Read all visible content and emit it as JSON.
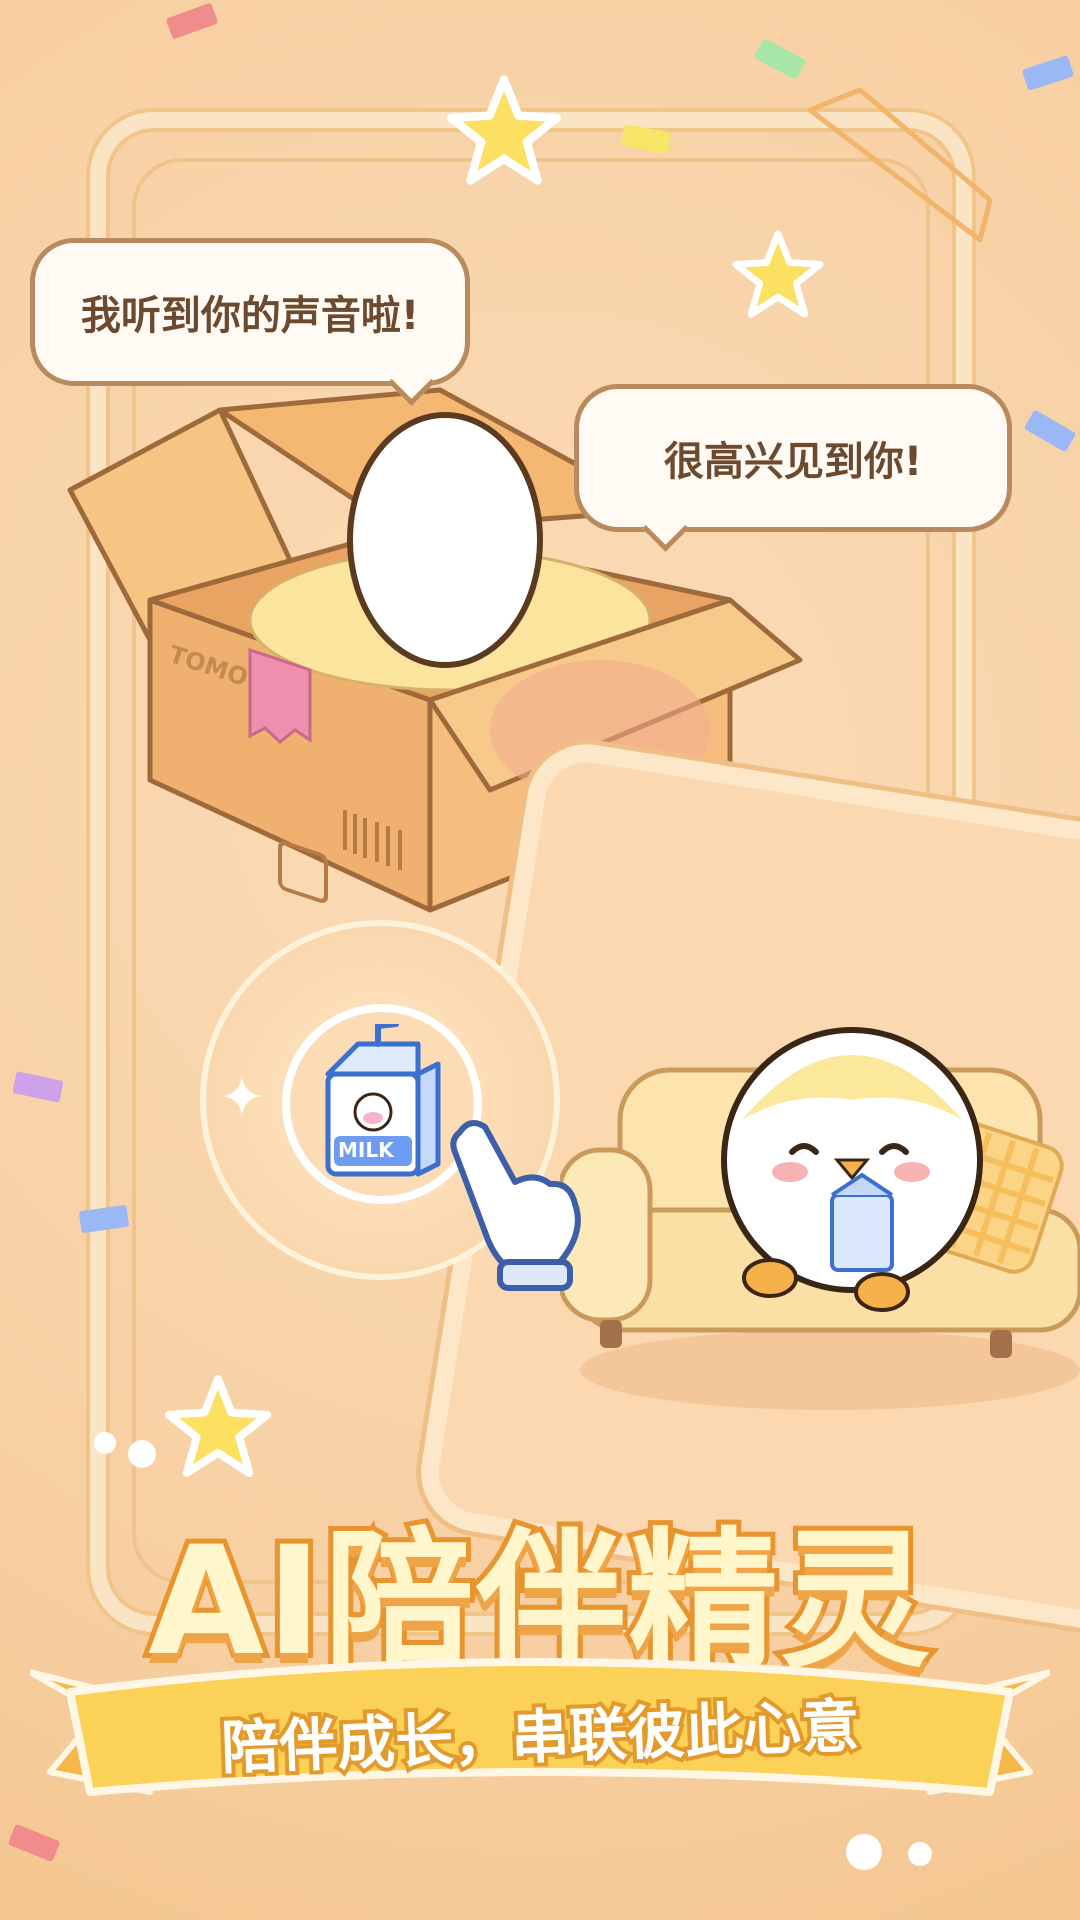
{
  "speech_bubbles": {
    "left": "我听到你的声音啦!",
    "right": "很高兴见到你!"
  },
  "box": {
    "brand": "TOMO"
  },
  "milk_label": "MILK",
  "banner": {
    "title": "AI陪伴精灵",
    "subtitle": "陪伴成长，串联彼此心意"
  },
  "colors": {
    "background": "#f9d5ad",
    "title_fill": "#fff6cc",
    "title_stroke": "#e8952f",
    "ribbon": "#fbd257",
    "bubble_text": "#6b4a2f"
  },
  "icons": [
    "star-icon",
    "milk-carton-icon",
    "pointing-hand-icon",
    "sparkle-icon",
    "paw-icon",
    "barcode-icon"
  ]
}
